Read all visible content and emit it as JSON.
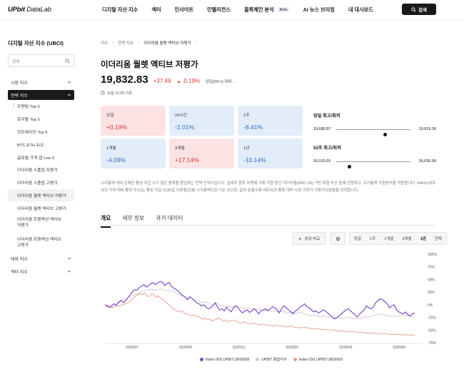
{
  "brand": {
    "name_bold": "UPbit",
    "name_rest": " DataLab"
  },
  "nav": [
    {
      "label": "디지털 자산 지수"
    },
    {
      "label": "섹터"
    },
    {
      "label": "인사이트"
    },
    {
      "label": "인텔리전스"
    },
    {
      "label": "블록체인 분석",
      "badge": "Beta"
    },
    {
      "label": "AI 뉴스 브리핑"
    },
    {
      "label": "내 대시보드"
    }
  ],
  "search_button": {
    "label": "검색"
  },
  "sidebar": {
    "title": "디지털 자산 지수 (UBCI)",
    "search_placeholder": "검색",
    "sections": {
      "market": "시장 지수",
      "strategy": "전략 지수",
      "theme": "테마 지수",
      "sector": "섹터 지수"
    },
    "items": [
      "모멘텀 Top 5",
      "로우볼 Top 5",
      "컨트래리안 Top 5",
      "BTC-ETH 듀오",
      "글로벌 가격 갭 Low 5",
      "이더리움 스플립 저평가",
      "이더리움 스플립 고평가",
      "이더리움 월렛 액티브 저평가",
      "이더리움 월렛 액티브 고평가",
      "이더리움 트랜잭션 액티브 저평가",
      "이더리움 트랜잭션 액티브 고평가"
    ]
  },
  "breadcrumb": [
    "지수",
    "전략 지수",
    "이더리움 월렛 액티브 저평가"
  ],
  "index": {
    "title": "이더리움 월렛 액티브 저평가",
    "price": "19,832.83",
    "change": "+37.49",
    "change_arrow": "▲",
    "change_pct": "0.19%",
    "basis": "당일(09시) 대비",
    "timestamp": "오늘 11:03 기준"
  },
  "returns": [
    {
      "label": "당일",
      "value": "+0.19%",
      "dir": "pos"
    },
    {
      "label": "24시간",
      "value": "-2.01%",
      "dir": "neg"
    },
    {
      "label": "1주",
      "value": "-8.41%",
      "dir": "neg"
    },
    {
      "label": "1개월",
      "value": "-4.09%",
      "dir": "neg"
    },
    {
      "label": "3개월",
      "value": "+17.14%",
      "dir": "pos"
    },
    {
      "label": "1년",
      "value": "-10.14%",
      "dir": "neg"
    }
  ],
  "ranges": {
    "day": {
      "title": "당일 최고/최저",
      "low": "19,680.97",
      "high": "19,919.36",
      "position": 0.66
    },
    "year": {
      "title": "52주 최고/최저",
      "low": "16,015.01",
      "high": "36,630.68",
      "position": 0.18
    }
  },
  "description": "시가총액 대비 온체인 활성 지갑 수가 많은 종목을 편입하는 전략 인덱스입니다. 업비트 원화 마켓에 거래 지원 중인 이더리움(ERC-20) 기반 대형 자산 중에 선정하고, 시가총액 가중방식을 적용합니다. AANV(네트워크 가치 대비 활성 주소)는 활성 지갑 수(30일 이동평균)를 시가총액으로 나눈 것으로, 값이 높을수록 네트워크 활동 대비 시장 가치가 저평가되었음을 의미합니다.",
  "tabs": [
    "개요",
    "세부 정보",
    "과거 데이터"
  ],
  "toolbar": {
    "compare_label": "성과 비교",
    "periods": [
      "당일",
      "1주",
      "1개월",
      "3개월",
      "1년",
      "전체"
    ],
    "active_period": "1년"
  },
  "colors": {
    "up": "#e5322d",
    "down": "#2e6bc6",
    "series1": "#7a3fd1",
    "series2": "#c9c9d4",
    "series3": "#e59a8c"
  },
  "chart_data": {
    "type": "line",
    "x_ticks": [
      "2025/07",
      "2025/09",
      "2025/11",
      "2026/01",
      "2026/03",
      "2026/05"
    ],
    "y_ticks": [
      "100%",
      "75%",
      "50%",
      "25%",
      "0%",
      "-25%",
      "-50%",
      "-75%"
    ],
    "ylim": [
      -75,
      100
    ],
    "y_unit": "%",
    "series": [
      {
        "name": "Index IDX.UPBIT.UBSI008",
        "color": "#7a3fd1",
        "values": [
          0,
          -3,
          -5,
          -2,
          2,
          -1,
          5,
          9,
          4,
          8,
          14,
          20,
          26,
          30,
          29,
          34,
          37,
          40,
          35,
          38,
          42,
          44,
          40,
          43,
          46,
          45,
          38,
          42,
          44,
          36,
          33,
          30,
          27,
          22,
          18,
          15,
          10,
          16,
          12,
          8,
          4,
          2,
          -2,
          0,
          -4,
          -8,
          -6,
          -2,
          4,
          -4,
          -10,
          -8,
          -12,
          -5,
          -10,
          -14,
          -6,
          -2,
          -6,
          -12,
          -16,
          -12,
          -10,
          -15,
          -12,
          -8,
          -12,
          -18,
          -12,
          -10,
          -8,
          -12,
          -8,
          -4,
          -6,
          -10,
          -16,
          -8,
          -2,
          -6,
          -10,
          -14,
          -18,
          -12,
          -10,
          -4,
          -2,
          2,
          -4,
          -6,
          -10,
          -14,
          -12,
          -16,
          -14,
          -10,
          -12,
          -16,
          -20,
          -24,
          -28,
          -26,
          -22,
          -18,
          -14,
          -10,
          -8,
          -12,
          -16,
          -20,
          -24,
          -18,
          -14,
          -10,
          -2,
          -6,
          -8,
          -4,
          4,
          8,
          12,
          10,
          6,
          2,
          -6,
          -2,
          0,
          -10,
          -14,
          -16,
          -18,
          -14,
          -20,
          -22,
          -18,
          -16
        ]
      },
      {
        "name": "UPBIT 종합지수",
        "color": "#c9c9d4",
        "values": [
          0,
          -2,
          -3,
          -1,
          2,
          4,
          6,
          8,
          10,
          12,
          14,
          16,
          18,
          20,
          22,
          24,
          26,
          28,
          29,
          30,
          31,
          30,
          29,
          30,
          31,
          30,
          28,
          29,
          26,
          27,
          24,
          22,
          20,
          18,
          16,
          14,
          12,
          14,
          12,
          10,
          8,
          6,
          4,
          6,
          4,
          2,
          0,
          2,
          4,
          0,
          -2,
          -1,
          -4,
          -2,
          -5,
          -4,
          -2,
          -3,
          -5,
          -6,
          -8,
          -6,
          -7,
          -8,
          -10,
          -9,
          -8,
          -10,
          -12,
          -11,
          -10,
          -12,
          -13,
          -12,
          -14,
          -13,
          -12,
          -14,
          -16,
          -15,
          -14,
          -16,
          -17,
          -16,
          -15,
          -17,
          -18,
          -20,
          -22,
          -21,
          -20,
          -22,
          -24,
          -23,
          -22,
          -24,
          -25,
          -24,
          -26,
          -25,
          -24,
          -26,
          -27,
          -26,
          -25,
          -24,
          -26,
          -27,
          -28,
          -27,
          -26,
          -25,
          -24,
          -23,
          -24,
          -22,
          -20,
          -19,
          -18,
          -20,
          -21,
          -20,
          -22,
          -23,
          -22,
          -24,
          -23,
          -22,
          -21,
          -20,
          -22,
          -23,
          -24,
          -25
        ]
      },
      {
        "name": "Index IDX.UPBIT.UBSI009",
        "color": "#e59a8c",
        "values": [
          0,
          -1,
          -4,
          -6,
          -4,
          -2,
          -3,
          -1,
          1,
          2,
          4,
          8,
          12,
          16,
          20,
          22,
          20,
          24,
          18,
          16,
          22,
          20,
          14,
          18,
          12,
          10,
          6,
          2,
          -2,
          -6,
          -10,
          -12,
          -14,
          -12,
          -16,
          -18,
          -20,
          -22,
          -20,
          -24,
          -22,
          -26,
          -28,
          -26,
          -30,
          -28,
          -32,
          -30,
          -28,
          -26,
          -30,
          -32,
          -30,
          -34,
          -32,
          -30,
          -32,
          -34,
          -36,
          -35,
          -34,
          -36,
          -38,
          -37,
          -36,
          -38,
          -40,
          -39,
          -38,
          -40,
          -41,
          -40,
          -42,
          -41,
          -40,
          -42,
          -43,
          -42,
          -44,
          -43,
          -42,
          -44,
          -45,
          -44,
          -46,
          -45,
          -44,
          -46,
          -47,
          -46,
          -48,
          -47,
          -48,
          -49,
          -48,
          -50,
          -49,
          -50,
          -51,
          -50,
          -52,
          -51,
          -52,
          -53,
          -52,
          -53,
          -54,
          -53,
          -54,
          -55,
          -54,
          -55,
          -56,
          -55,
          -56,
          -57,
          -56,
          -57,
          -58,
          -57,
          -58,
          -57,
          -58,
          -59,
          -58,
          -59,
          -58,
          -59,
          -60,
          -59,
          -60,
          -59,
          -60,
          -60
        ]
      }
    ],
    "grid": false,
    "legend_position": "bottom-center"
  }
}
